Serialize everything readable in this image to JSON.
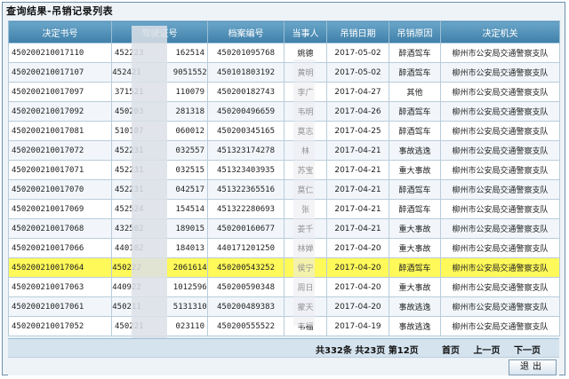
{
  "window_title": "查询结果-吊销记录列表",
  "columns": [
    "决定书号",
    "驾驶证号",
    "档案编号",
    "当事人",
    "吊销日期",
    "吊销原因",
    "决定机关"
  ],
  "rows": [
    [
      "450200210017110",
      "452223",
      "162514",
      "450201095768",
      "姚德",
      "2017-05-02",
      "醉酒驾车",
      "柳州市公安局交通警察支队"
    ],
    [
      "450200210017107",
      "452421",
      "9051552",
      "450101803192",
      "黄明",
      "2017-05-02",
      "醉酒驾车",
      "柳州市公安局交通警察支队"
    ],
    [
      "450200210017097",
      "371521",
      "110079",
      "450200182743",
      "李广",
      "2017-04-27",
      "其他",
      "柳州市公安局交通警察支队"
    ],
    [
      "450200210017092",
      "450203",
      "281318",
      "450200496659",
      "韦明",
      "2017-04-26",
      "醉酒驾车",
      "柳州市公安局交通警察支队"
    ],
    [
      "450200210017081",
      "510107",
      "060012",
      "450200345165",
      "莫志",
      "2017-04-25",
      "醉酒驾车",
      "柳州市公安局交通警察支队"
    ],
    [
      "450200210017072",
      "452231",
      "032557",
      "451323174278",
      "林",
      "2017-04-21",
      "事故逃逸",
      "柳州市公安局交通警察支队"
    ],
    [
      "450200210017071",
      "452231",
      "032515",
      "451323403935",
      "苏宝",
      "2017-04-21",
      "重大事故",
      "柳州市公安局交通警察支队"
    ],
    [
      "450200210017070",
      "452231",
      "042517",
      "451322365516",
      "莫仁",
      "2017-04-21",
      "醉酒驾车",
      "柳州市公安局交通警察支队"
    ],
    [
      "450200210017069",
      "452524",
      "154514",
      "451322280693",
      "张",
      "2017-04-21",
      "醉酒驾车",
      "柳州市公安局交通警察支队"
    ],
    [
      "450200210017068",
      "432502",
      "189015",
      "450200160677",
      "姜千",
      "2017-04-21",
      "重大事故",
      "柳州市公安局交通警察支队"
    ],
    [
      "450200210017066",
      "440102",
      "184013",
      "440171201250",
      "林婵",
      "2017-04-20",
      "重大事故",
      "柳州市公安局交通警察支队"
    ],
    [
      "450200210017064",
      "450222",
      "2061614",
      "450200543252",
      "侯宁",
      "2017-04-20",
      "醉酒驾车",
      "柳州市公安局交通警察支队"
    ],
    [
      "450200210017063",
      "440922",
      "1012596",
      "450200590348",
      "周日",
      "2017-04-20",
      "重大事故",
      "柳州市公安局交通警察支队"
    ],
    [
      "450200210017061",
      "450211",
      "5131310",
      "450200489383",
      "蒙天",
      "2017-04-20",
      "事故逃逸",
      "柳州市公安局交通警察支队"
    ],
    [
      "450200210017052",
      "450221",
      "023110",
      "450200555522",
      "韦福",
      "2017-04-19",
      "事故逃逸",
      "柳州市公安局交通警察支队"
    ]
  ],
  "highlight_row": 11,
  "pager": {
    "total_records": "共332条",
    "total_pages": "共23页",
    "current_page": "第12页",
    "first": "首页",
    "prev": "上一页",
    "next": "下一页",
    "last": "末页"
  },
  "exit_label": "退出",
  "colors": {
    "header": "#4f8fb8",
    "highlight": "#fff95a"
  }
}
